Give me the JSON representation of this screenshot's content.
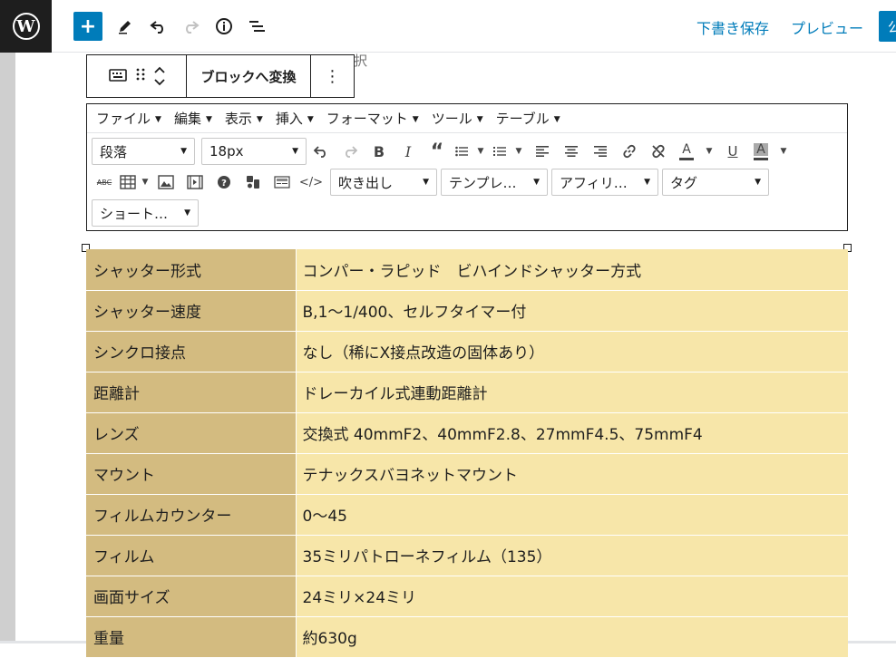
{
  "topbar": {
    "save_draft": "下書き保存",
    "preview": "プレビュー",
    "publish": "公"
  },
  "ghost_text": "択",
  "block_toolbar": {
    "convert_label": "ブロックへ変換"
  },
  "mce": {
    "menus": [
      "ファイル",
      "編集",
      "表示",
      "挿入",
      "フォーマット",
      "ツール",
      "テーブル"
    ],
    "format_select": "段落",
    "size_select": "18px",
    "balloon_select": "吹き出し",
    "template_select": "テンプレ…",
    "affiliate_select": "アフィリ…",
    "tag_select": "タグ",
    "shortcode_select": "ショート…"
  },
  "table": {
    "rows": [
      {
        "key": "シャッター形式",
        "value": "コンパー・ラピッド　ビハインドシャッター方式"
      },
      {
        "key": "シャッター速度",
        "value": "B,1〜1/400、セルフタイマー付"
      },
      {
        "key": "シンクロ接点",
        "value": "なし（稀にX接点改造の固体あり）"
      },
      {
        "key": "距離計",
        "value": "ドレーカイル式連動距離計"
      },
      {
        "key": "レンズ",
        "value": "交換式 40mmF2、40mmF2.8、27mmF4.5、75mmF4"
      },
      {
        "key": "マウント",
        "value": "テナックスバヨネットマウント"
      },
      {
        "key": "フィルムカウンター",
        "value": "0〜45"
      },
      {
        "key": "フィルム",
        "value": "35ミリパトローネフィルム（135）"
      },
      {
        "key": "画面サイズ",
        "value": "24ミリ×24ミリ"
      },
      {
        "key": "重量",
        "value": "約630g"
      }
    ]
  }
}
